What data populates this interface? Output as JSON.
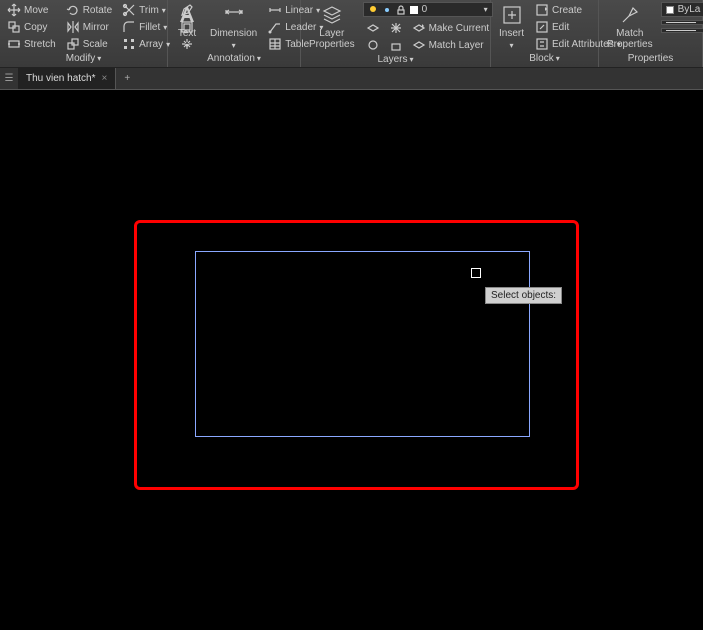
{
  "ribbon": {
    "modify": {
      "title": "Modify",
      "move": "Move",
      "rotate": "Rotate",
      "trim": "Trim",
      "copy": "Copy",
      "mirror": "Mirror",
      "fillet": "Fillet",
      "stretch": "Stretch",
      "scale": "Scale",
      "array": "Array"
    },
    "annotation": {
      "title": "Annotation",
      "text": "Text",
      "dimension": "Dimension",
      "linear": "Linear",
      "leader": "Leader",
      "table": "Table"
    },
    "layers": {
      "title": "Layers",
      "layer_properties": "Layer\nProperties",
      "current_layer": "0",
      "make_current": "Make Current",
      "match_layer": "Match Layer"
    },
    "block": {
      "title": "Block",
      "insert": "Insert",
      "create": "Create",
      "edit": "Edit",
      "edit_attrs": "Edit Attributes"
    },
    "props": {
      "title": "Properties",
      "match_properties": "Match\nProperties",
      "color": "ByLa"
    }
  },
  "tabs": {
    "active": "Thu vien hatch*"
  },
  "tooltip": "Select objects:"
}
